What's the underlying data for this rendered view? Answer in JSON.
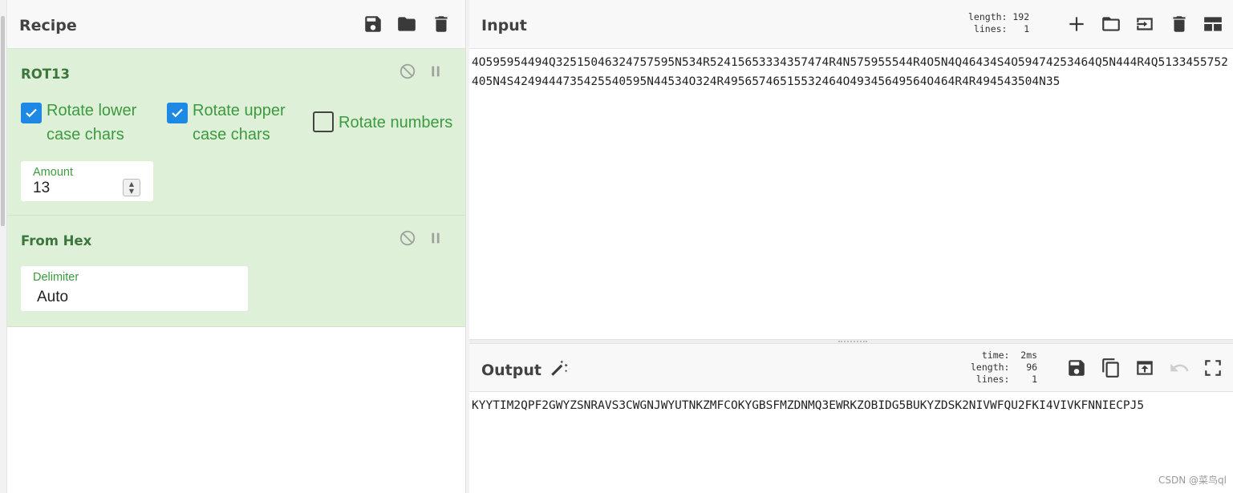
{
  "recipe": {
    "title": "Recipe",
    "operations": [
      {
        "name": "ROT13",
        "options": [
          {
            "label_line1": "Rotate lower",
            "label_line2": "case chars",
            "checked": true
          },
          {
            "label_line1": "Rotate upper",
            "label_line2": "case chars",
            "checked": true
          },
          {
            "label": "Rotate numbers",
            "checked": false
          }
        ],
        "amount": {
          "label": "Amount",
          "value": "13"
        }
      },
      {
        "name": "From Hex",
        "delimiter": {
          "label": "Delimiter",
          "value": "Auto"
        }
      }
    ]
  },
  "input": {
    "title": "Input",
    "stats": "length: 192\n lines:   1",
    "text": "4O595954494Q32515046324757595N534R52415653334357474R4N575955544R4O5N4Q46434S4O59474253464Q5N444R4Q5133455752405N4S4249444735425540595N44534O324R49565746515532464O49345649564O464R4R494543504N35"
  },
  "output": {
    "title": "Output",
    "stats": "  time:  2ms\nlength:   96\n lines:    1",
    "text": "KYYTIM2QPF2GWYZSNRAVS3CWGNJWYUTNKZMFCOKYGBSFMZDNMQ3EWRKZOBIDG5BUKYZDSK2NIVWFQU2FKI4VIVKFNNIECPJ5"
  },
  "watermark": "CSDN @菜鸟ql",
  "colors": {
    "op_background": "#dff0d8",
    "op_title": "#3c763d",
    "checkbox_on": "#1e88e5"
  }
}
